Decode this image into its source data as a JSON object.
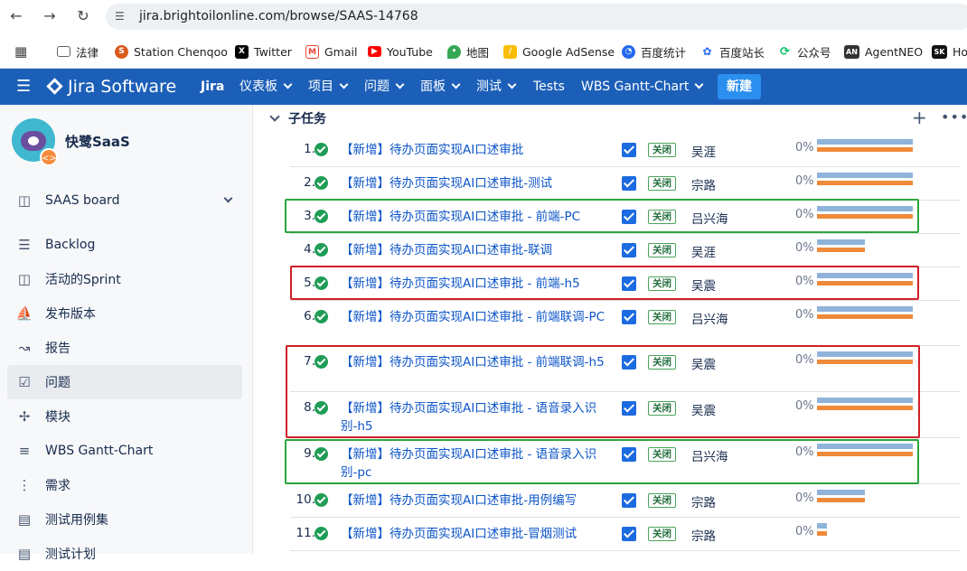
{
  "browser": {
    "url": "jira.brightoilonline.com/browse/SAAS-14768",
    "bookmarks": [
      {
        "label": "法律",
        "icon": "folder-icon",
        "color": "#5f6368"
      },
      {
        "label": "Station Chenqoo",
        "icon": "station-icon",
        "color": "#d85a1e"
      },
      {
        "label": "Twitter",
        "icon": "x-logo-icon",
        "color": "#000000"
      },
      {
        "label": "Gmail",
        "icon": "gmail-icon",
        "color": "#ea4335"
      },
      {
        "label": "YouTube",
        "icon": "youtube-icon",
        "color": "#ff0000"
      },
      {
        "label": "地图",
        "icon": "maps-pin-icon",
        "color": "#34a853"
      },
      {
        "label": "Google AdSense",
        "icon": "adsense-icon",
        "color": "#fbbc04"
      },
      {
        "label": "百度统计",
        "icon": "baidu-stats-icon",
        "color": "#2468f2"
      },
      {
        "label": "百度站长",
        "icon": "baidu-paw-icon",
        "color": "#2468f2"
      },
      {
        "label": "公众号",
        "icon": "wechat-icon",
        "color": "#07c160"
      },
      {
        "label": "AgentNEO",
        "icon": "agentneo-icon",
        "color": "#333333"
      },
      {
        "label": "Ho",
        "icon": "sk-icon",
        "color": "#111111"
      }
    ]
  },
  "topnav": {
    "product": "Jira Software",
    "jira": "Jira",
    "menus": [
      "仪表板",
      "项目",
      "问题",
      "面板",
      "测试"
    ],
    "tests": "Tests",
    "wbs": "WBS Gantt-Chart",
    "create": "新建",
    "bg_color": "#1c5fb8"
  },
  "sidebar": {
    "project_name": "快鹭SaaS",
    "board": "SAAS board",
    "items": [
      {
        "label": "Backlog",
        "icon": "backlog-icon"
      },
      {
        "label": "活动的Sprint",
        "icon": "sprint-board-icon"
      },
      {
        "label": "发布版本",
        "icon": "ship-icon"
      },
      {
        "label": "报告",
        "icon": "report-chart-icon"
      },
      {
        "label": "问题",
        "icon": "issues-icon"
      },
      {
        "label": "模块",
        "icon": "puzzle-icon"
      },
      {
        "label": "WBS Gantt-Chart",
        "icon": "gantt-icon"
      },
      {
        "label": "需求",
        "icon": "requirements-icon"
      },
      {
        "label": "测试用例集",
        "icon": "test-suite-icon"
      },
      {
        "label": "测试计划",
        "icon": "test-plan-icon"
      }
    ],
    "active_item": "问题"
  },
  "subtasks": {
    "title": "子任务",
    "rows": [
      {
        "num": "1.",
        "title": "【新增】待办页面实现AI口述审批",
        "status": "关闭",
        "assignee": "吴涯",
        "pct": "0%",
        "progress_blue": 1.0,
        "progress_orange": 1.0
      },
      {
        "num": "2.",
        "title": "【新增】待办页面实现AI口述审批-测试",
        "status": "关闭",
        "assignee": "宗路",
        "pct": "0%",
        "progress_blue": 1.0,
        "progress_orange": 1.0
      },
      {
        "num": "3.",
        "title": "【新增】待办页面实现AI口述审批 - 前端-PC",
        "status": "关闭",
        "assignee": "吕兴海",
        "pct": "0%",
        "progress_blue": 1.0,
        "progress_orange": 1.0
      },
      {
        "num": "4.",
        "title": "【新增】待办页面实现AI口述审批-联调",
        "status": "关闭",
        "assignee": "吴涯",
        "pct": "0%",
        "progress_blue": 0.5,
        "progress_orange": 0.5
      },
      {
        "num": "5.",
        "title": "【新增】待办页面实现AI口述审批 - 前端-h5",
        "status": "关闭",
        "assignee": "吴震",
        "pct": "0%",
        "progress_blue": 1.0,
        "progress_orange": 1.0
      },
      {
        "num": "6.",
        "title": "【新增】待办页面实现AI口述审批 - 前端联调-PC",
        "status": "关闭",
        "assignee": "吕兴海",
        "pct": "0%",
        "progress_blue": 1.0,
        "progress_orange": 1.0
      },
      {
        "num": "7.",
        "title": "【新增】待办页面实现AI口述审批 - 前端联调-h5",
        "status": "关闭",
        "assignee": "吴震",
        "pct": "0%",
        "progress_blue": 1.0,
        "progress_orange": 1.0
      },
      {
        "num": "8.",
        "title": "【新增】待办页面实现AI口述审批 - 语音录入识别-h5",
        "status": "关闭",
        "assignee": "吴震",
        "pct": "0%",
        "progress_blue": 1.0,
        "progress_orange": 1.0
      },
      {
        "num": "9.",
        "title": "【新增】待办页面实现AI口述审批 - 语音录入识别-pc",
        "status": "关闭",
        "assignee": "吕兴海",
        "pct": "0%",
        "progress_blue": 1.0,
        "progress_orange": 1.0
      },
      {
        "num": "10.",
        "title": "【新增】待办页面实现AI口述审批-用例编写",
        "status": "关闭",
        "assignee": "宗路",
        "pct": "0%",
        "progress_blue": 0.5,
        "progress_orange": 0.5
      },
      {
        "num": "11.",
        "title": "【新增】待办页面实现AI口述审批-冒烟测试",
        "status": "关闭",
        "assignee": "宗路",
        "pct": "0%",
        "progress_blue": 0.1,
        "progress_orange": 0.1
      }
    ]
  },
  "highlight_colors": {
    "green": "#2ca53c",
    "red": "#d11e27"
  }
}
